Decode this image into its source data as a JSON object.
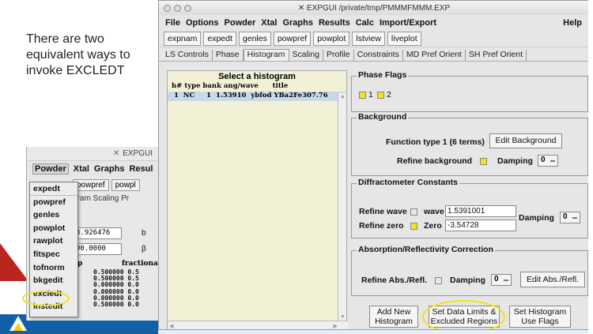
{
  "slide": {
    "text": "There are two equivalent ways to invoke EXCLEDT"
  },
  "small_window": {
    "title": "EXPGUI",
    "menubar": [
      "Powder",
      "Xtal",
      "Graphs",
      "Resul"
    ],
    "buttons": [
      "powpref",
      "powpl"
    ],
    "tabs": "gram  Scaling  Pr",
    "field_1": "3.926476",
    "field_1_symbol": "b",
    "field_2": "90.0000",
    "field_2_symbol": "β",
    "grid_header": "fractional",
    "grid_col_label": "p",
    "grid_rows": [
      "0.500000  0.5",
      "0.500000  0.5",
      "0.000000  0.0",
      "0.000000  0.0",
      "0.000000  0.0",
      "0.500000  0.0"
    ],
    "zero_column": [
      "0",
      "0",
      "0",
      "0",
      "0",
      "0"
    ],
    "powder_menu": [
      "expedt",
      "powpref",
      "genles",
      "powplot",
      "rawplot",
      "fitspec",
      "tofnorm",
      "bkgedit",
      "excledt",
      "instedit"
    ]
  },
  "window": {
    "title": "EXPGUI /private/tmp/PMMMFMMM.EXP",
    "menubar": [
      "File",
      "Options",
      "Powder",
      "Xtal",
      "Graphs",
      "Results",
      "Calc",
      "Import/Export"
    ],
    "help": "Help",
    "buttons": [
      "expnam",
      "expedt",
      "genles",
      "powpref",
      "powplot",
      "lstview",
      "liveplot"
    ],
    "tabs": [
      "LS Controls",
      "Phase",
      "Histogram",
      "Scaling",
      "Profile",
      "Constraints",
      "MD Pref Orient",
      "SH Pref Orient"
    ],
    "selected_tab": "Histogram"
  },
  "histogram_list": {
    "header": "Select a histogram",
    "columns": "h# type bank ang/wave      title",
    "rows": [
      " 1  NC     1  1.53910  ybfod YBa2Fe307.76"
    ]
  },
  "phase_flags": {
    "title": "Phase Flags",
    "flag_1": "1",
    "flag_2": "2"
  },
  "background": {
    "title": "Background",
    "function_label": "Function type 1 (6 terms)",
    "edit_button": "Edit Background",
    "refine_label": "Refine background",
    "damping_label": "Damping",
    "damping_value": "0"
  },
  "diffractometer": {
    "title": "Diffractometer Constants",
    "refine_wave_label": "Refine wave",
    "wave_label": "wave",
    "wave_value": "1.5391001",
    "refine_zero_label": "Refine zero",
    "zero_label": "Zero",
    "zero_value": "-3.54728",
    "damping_label": "Damping",
    "damping_value": "0"
  },
  "absorption": {
    "title": "Absorption/Reflectivity Correction",
    "refine_label": "Refine Abs./Refl.",
    "damping_label": "Damping",
    "damping_value": "0",
    "edit_button": "Edit Abs./Refl."
  },
  "bottom_buttons": {
    "add_new_1": "Add New",
    "add_new_2": "Histogram",
    "set_limits_1": "Set Data Limits &",
    "set_limits_2": "Excluded Regions",
    "set_flags_1": "Set Histogram",
    "set_flags_2": "Use Flags"
  },
  "colors": {
    "flag_yellow": "#f3e31f",
    "highlight_ellipse": "#f2e21a",
    "list_bg": "#f2f1d6",
    "selected_row": "#c9d9ea"
  }
}
